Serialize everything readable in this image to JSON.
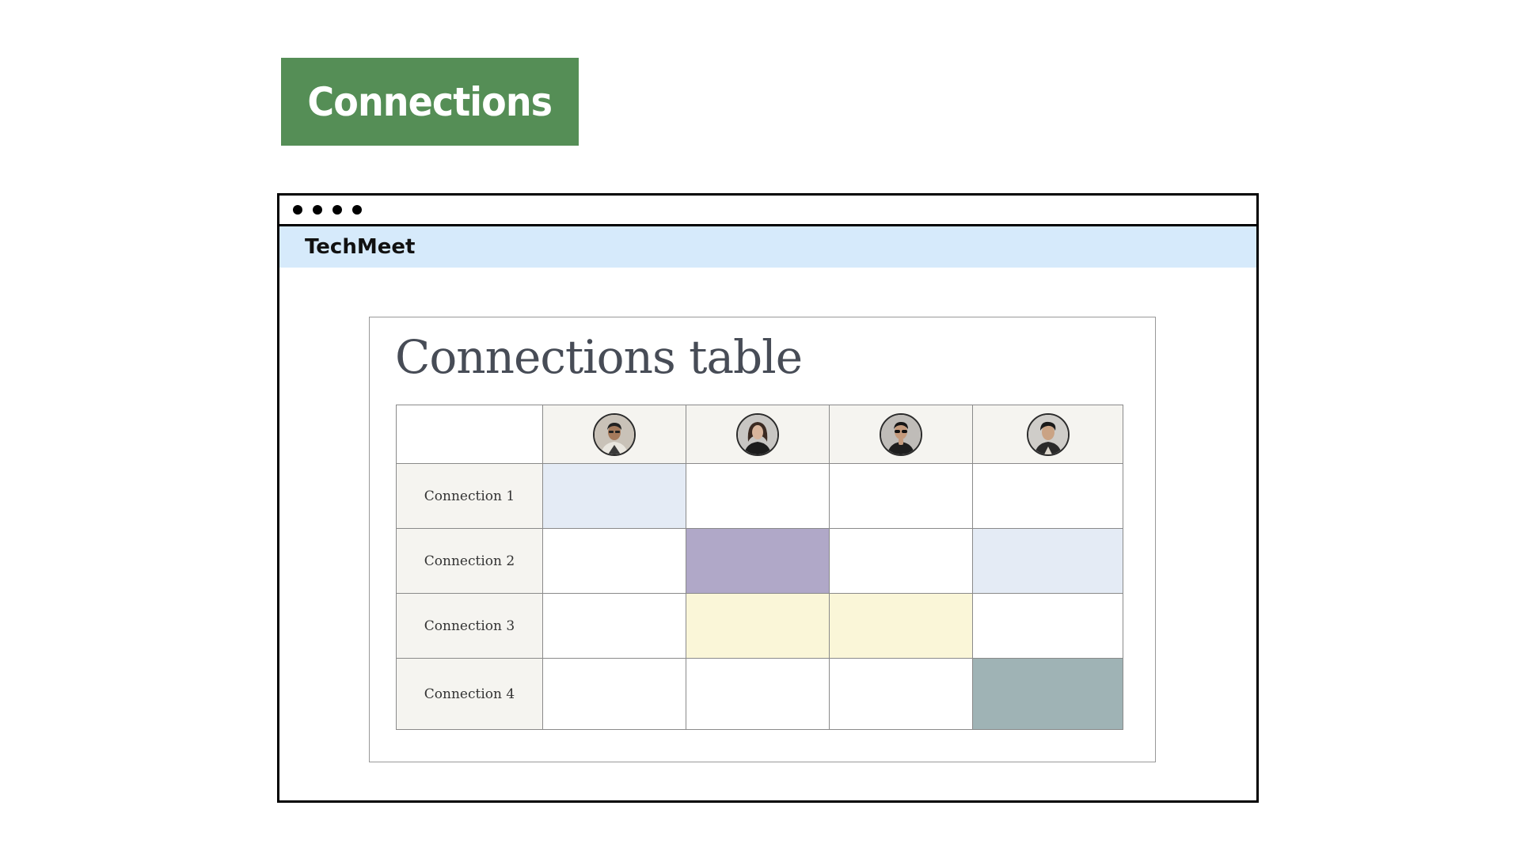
{
  "banner": {
    "label": "Connections",
    "color": "#558e56"
  },
  "app": {
    "name": "TechMeet",
    "bar_color": "#d6eafb"
  },
  "card": {
    "title": "Connections table"
  },
  "table": {
    "columns": [
      {
        "avatar": "person-avatar-1"
      },
      {
        "avatar": "person-avatar-2"
      },
      {
        "avatar": "person-avatar-3"
      },
      {
        "avatar": "person-avatar-4"
      }
    ],
    "rows": [
      {
        "label": "Connection 1",
        "cells": [
          "#e4ebf5",
          "#ffffff",
          "#ffffff",
          "#ffffff"
        ]
      },
      {
        "label": "Connection 2",
        "cells": [
          "#ffffff",
          "#b0a8c8",
          "#ffffff",
          "#e4ebf5"
        ]
      },
      {
        "label": "Connection 3",
        "cells": [
          "#ffffff",
          "#faf6d8",
          "#faf6d8",
          "#ffffff"
        ]
      },
      {
        "label": "Connection 4",
        "cells": [
          "#ffffff",
          "#ffffff",
          "#ffffff",
          "#9fb3b5"
        ]
      }
    ]
  }
}
